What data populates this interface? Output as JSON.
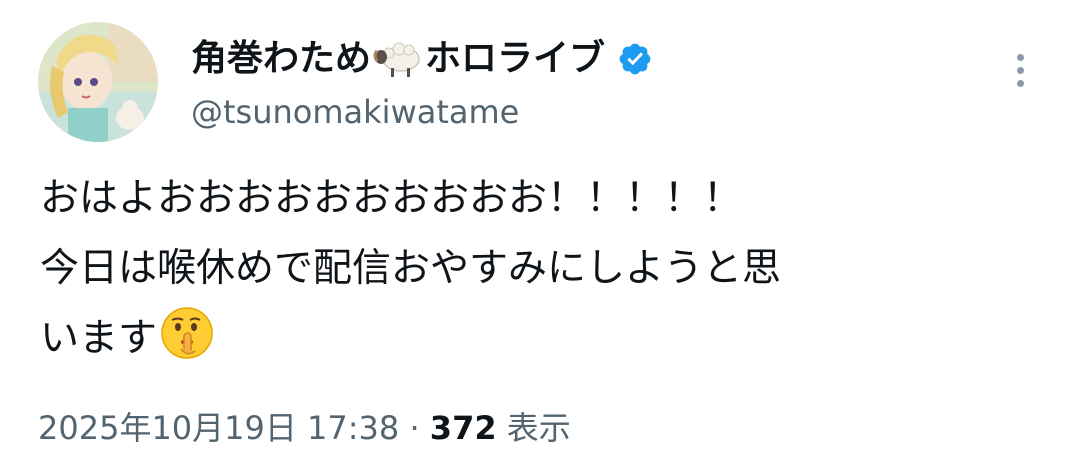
{
  "author": {
    "display_name": "角巻わため",
    "name_emoji": "sheep-icon",
    "org_name": "ホロライブ",
    "verified_icon": "verified-badge-icon",
    "handle": "@tsunomakiwatame",
    "avatar": "avatar"
  },
  "menu": {
    "icon": "more-vertical-icon"
  },
  "tweet": {
    "lines": [
      "おはよおおおおおおおおおお！！！！！",
      "今日は喉休めで配信おやすみにしようと思",
      "います"
    ],
    "trailing_emoji": "shushing-face-icon"
  },
  "meta": {
    "timestamp": "2025年10月19日 17:38",
    "separator": "·",
    "views_count": "372",
    "views_label": "表示"
  },
  "colors": {
    "text_primary": "#0f1419",
    "text_secondary": "#536471",
    "verified_blue": "#1d9bf0"
  }
}
